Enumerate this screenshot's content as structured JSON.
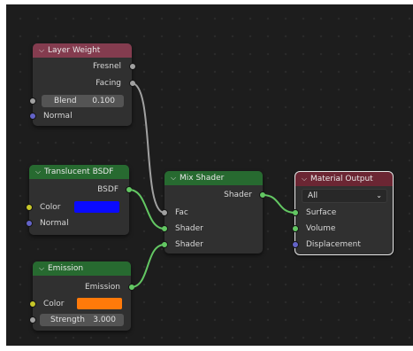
{
  "editor": {
    "background": "#1d1d1d",
    "wire_color_float": "#a1a1a1",
    "wire_color_shader": "#63c763"
  },
  "nodes": {
    "layer_weight": {
      "title": "Layer Weight",
      "header_color": "#843c4f",
      "chevron_icon": "chevron-down",
      "outputs": [
        "Fresnel",
        "Facing"
      ],
      "blend_label": "Blend",
      "blend_value": "0.100",
      "inputs": [
        "Normal"
      ]
    },
    "translucent": {
      "title": "Translucent BSDF",
      "header_color": "#276a30",
      "chevron_icon": "chevron-down",
      "output": "BSDF",
      "color_label": "Color",
      "color_value": "#0a0aff",
      "normal_label": "Normal"
    },
    "emission": {
      "title": "Emission",
      "header_color": "#276a30",
      "chevron_icon": "chevron-down",
      "output": "Emission",
      "color_label": "Color",
      "color_value": "#ff7a0a",
      "strength_label": "Strength",
      "strength_value": "3.000"
    },
    "mix_shader": {
      "title": "Mix Shader",
      "header_color": "#276a30",
      "chevron_icon": "chevron-down",
      "output": "Shader",
      "inputs": [
        "Fac",
        "Shader",
        "Shader"
      ]
    },
    "material_output": {
      "title": "Material Output",
      "header_color": "#6b2633",
      "chevron_icon": "chevron-down",
      "target_selected": "All",
      "inputs": [
        "Surface",
        "Volume",
        "Displacement"
      ]
    }
  }
}
